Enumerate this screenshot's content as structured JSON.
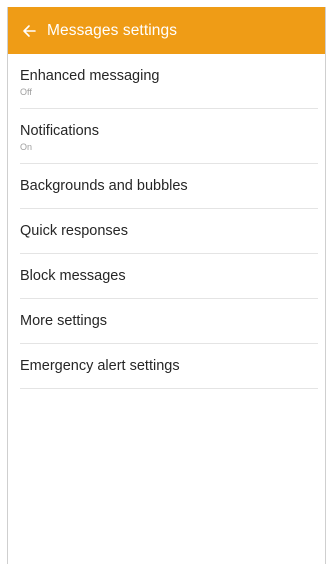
{
  "appbar": {
    "title": "Messages settings",
    "back_icon": "arrow-back-icon",
    "color": "#ef9c16"
  },
  "settings": {
    "items": [
      {
        "label": "Enhanced messaging",
        "sub": "Off"
      },
      {
        "label": "Notifications",
        "sub": "On"
      },
      {
        "label": "Backgrounds and bubbles"
      },
      {
        "label": "Quick responses"
      },
      {
        "label": "Block messages"
      },
      {
        "label": "More settings"
      },
      {
        "label": "Emergency alert settings"
      }
    ]
  }
}
